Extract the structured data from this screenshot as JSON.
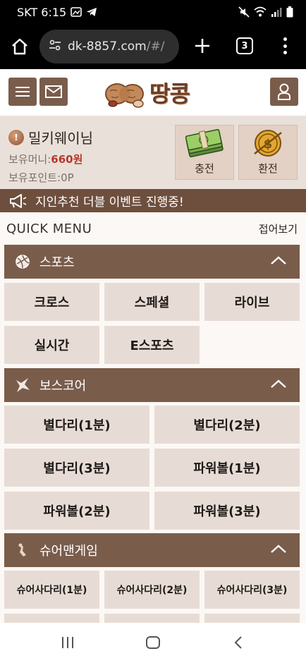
{
  "status_bar": {
    "carrier_time": "SKT 6:15"
  },
  "browser": {
    "url_main": "dk-8857.com",
    "url_rest": "/#/",
    "tab_count": "3"
  },
  "site": {
    "logo_text": "땅콩"
  },
  "user": {
    "name": "밀키웨이님",
    "money_label": "보유머니:",
    "money_value": "660원",
    "points_label": "보유포인트:",
    "points_value": "0P",
    "charge_label": "충전",
    "exchange_label": "환전"
  },
  "notice": {
    "text": "지인추천 더블 이벤트 진행중!"
  },
  "quick_menu": {
    "title": "QUICK MENU",
    "fold_label": "접어보기",
    "sports": {
      "title": "스포츠",
      "items": [
        "크로스",
        "스페셜",
        "라이브",
        "실시간",
        "E스포츠"
      ]
    },
    "boscore": {
      "title": "보스코어",
      "items": [
        "별다리(1분)",
        "별다리(2분)",
        "별다리(3분)",
        "파워볼(1분)",
        "파워볼(2분)",
        "파워볼(3분)"
      ]
    },
    "sureman": {
      "title": "슈어맨게임",
      "items": [
        "슈어사다리(1분)",
        "슈어사다리(2분)",
        "슈어사다리(3분)"
      ]
    }
  },
  "colors": {
    "brand_brown": "#7a5c4b",
    "notice_brown": "#6e4f3e",
    "money_red": "#b23a2e",
    "tile_bg": "#e7dcd5"
  }
}
